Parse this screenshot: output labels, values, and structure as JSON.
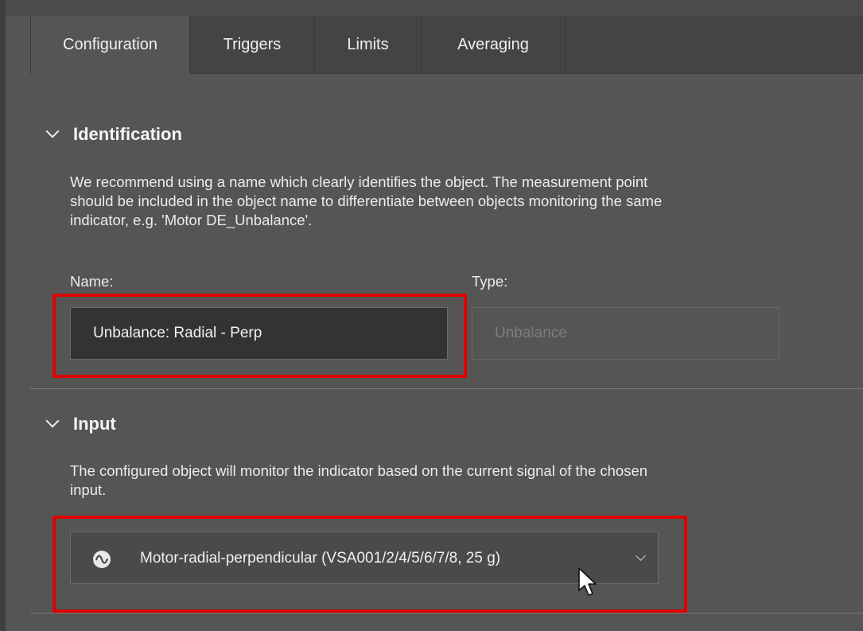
{
  "tabs": [
    {
      "label": "Configuration",
      "active": true
    },
    {
      "label": "Triggers",
      "active": false
    },
    {
      "label": "Limits",
      "active": false
    },
    {
      "label": "Averaging",
      "active": false
    }
  ],
  "identification": {
    "title": "Identification",
    "description_lines": [
      "We recommend using a name which clearly identifies the object. The measurement point",
      "should be included in the object name to differentiate between objects monitoring the same",
      "indicator, e.g. 'Motor DE_Unbalance'."
    ],
    "name_label": "Name:",
    "name_value": "Unbalance: Radial - Perp",
    "type_label": "Type:",
    "type_placeholder": "Unbalance"
  },
  "input": {
    "title": "Input",
    "description_lines": [
      "The configured object will monitor the indicator based on the current signal of the chosen",
      "input."
    ],
    "selected_input": "Motor-radial-perpendicular (VSA001/2/4/5/6/7/8, 25 g)",
    "input_icon": "sine-wave-icon"
  },
  "colors": {
    "highlight": "#e00000",
    "background": "#555555",
    "tabbar": "#444444",
    "input_bg": "#333333"
  },
  "icons": {
    "section_toggle": "chevron-down-icon",
    "dropdown": "chevron-down-icon",
    "pointer": "mouse-cursor-icon"
  }
}
